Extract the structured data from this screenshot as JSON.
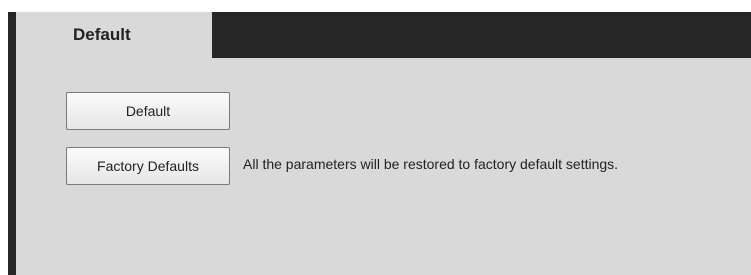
{
  "tabs": [
    {
      "label": "Default",
      "active": true
    }
  ],
  "buttons": {
    "default_label": "Default",
    "factory_label": "Factory Defaults"
  },
  "description": "All the parameters will be restored to factory default settings.",
  "colors": {
    "frame": "#262626",
    "panel": "#d9d9d9",
    "text": "#222222"
  }
}
